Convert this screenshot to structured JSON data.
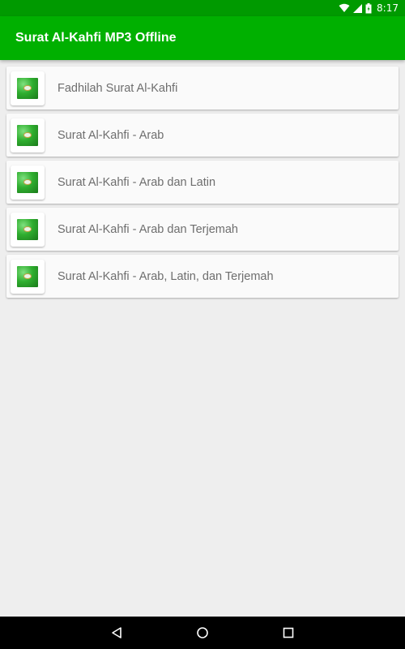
{
  "status_bar": {
    "time": "8:17",
    "icons": [
      "wifi-icon",
      "signal-icon",
      "battery-icon"
    ],
    "background": "#009a00"
  },
  "app_bar": {
    "title": "Surat Al-Kahfi MP3 Offline",
    "background": "#00b000"
  },
  "list": {
    "items": [
      {
        "label": "Fadhilah Surat Al-Kahfi",
        "icon": "quran-thumbnail-icon"
      },
      {
        "label": "Surat Al-Kahfi - Arab",
        "icon": "quran-thumbnail-icon"
      },
      {
        "label": "Surat Al-Kahfi - Arab dan Latin",
        "icon": "quran-thumbnail-icon"
      },
      {
        "label": "Surat Al-Kahfi - Arab dan Terjemah",
        "icon": "quran-thumbnail-icon"
      },
      {
        "label": "Surat Al-Kahfi - Arab, Latin, dan Terjemah",
        "icon": "quran-thumbnail-icon"
      }
    ]
  },
  "nav_bar": {
    "buttons": [
      "back-icon",
      "home-icon",
      "recents-icon"
    ]
  }
}
